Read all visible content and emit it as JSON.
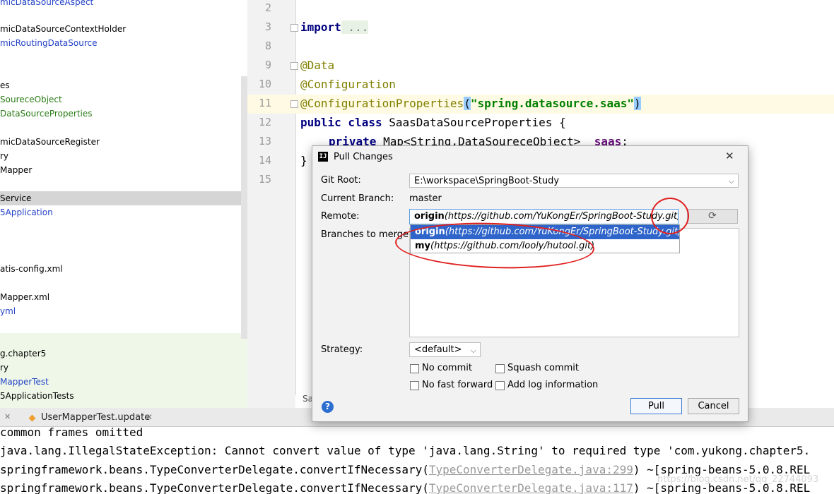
{
  "tree": {
    "items": [
      {
        "text": "micDataSourceAspect",
        "color": "blue"
      },
      {
        "text": "micDataSourceContextHolder",
        "color": "black"
      },
      {
        "text": "micRoutingDataSource",
        "color": "blue"
      },
      {
        "text": "es",
        "color": "black"
      },
      {
        "text": "SoureceObject",
        "color": "green"
      },
      {
        "text": "DataSourceProperties",
        "color": "green"
      },
      {
        "text": "micDataSourceRegister",
        "color": "black"
      },
      {
        "text": "ry",
        "color": "black"
      },
      {
        "text": "Mapper",
        "color": "black"
      },
      {
        "text": "Service",
        "color": "black"
      },
      {
        "text": "5Application",
        "color": "blue"
      },
      {
        "text": "atis-config.xml",
        "color": "black"
      },
      {
        "text": "Mapper.xml",
        "color": "black"
      },
      {
        "text": "yml",
        "color": "blue"
      },
      {
        "text": "g.chapter5",
        "color": "black"
      },
      {
        "text": "ry",
        "color": "black"
      },
      {
        "text": "MapperTest",
        "color": "blue"
      },
      {
        "text": "5ApplicationTests",
        "color": "black"
      }
    ]
  },
  "editor": {
    "line_numbers": [
      "2",
      "3",
      "8",
      "9",
      "10",
      "11",
      "12",
      "13",
      "14",
      "15"
    ],
    "code": {
      "import_kw": "import",
      "import_fold": " ...",
      "ann_data": "@Data",
      "ann_config": "@Configuration",
      "ann_props": "@ConfigurationProperties",
      "props_open": "(",
      "props_str": "\"spring.datasource.saas\"",
      "props_close": ")",
      "class_kw": "public class",
      "class_rest": " SaasDataSourceProperties {",
      "private_kw": "private",
      "field_type": " Map<String,DataSoureceObject>  ",
      "field_name": "saas",
      "field_end": ";",
      "closing": "}"
    },
    "sa_tab": "Sa"
  },
  "bottom_tab": {
    "label": "UserMapperTest.update",
    "close": "✕",
    "left_close": "✕"
  },
  "console": {
    "l1": "common frames omitted",
    "l2": "java.lang.IllegalStateException: Cannot convert value of type 'java.lang.String' to required type 'com.yukong.chapter5.",
    "l3_pre": "springframework.beans.TypeConverterDelegate.convertIfNecessary(",
    "l3_link": "TypeConverterDelegate.java:299",
    "l3_post": ") ~[spring-beans-5.0.8.REL",
    "l4_pre": "springframework.beans.TypeConverterDelegate.convertIfNecessary(",
    "l4_link": "TypeConverterDelegate.java:117",
    "l4_post": ") ~[spring-beans-5.0.8.REL",
    "watermark": "https://blog.csdn.net/qq_22744093"
  },
  "dialog": {
    "title": "Pull Changes",
    "close": "✕",
    "git_root_label": "Git Root:",
    "git_root_value": "E:\\workspace\\SpringBoot-Study",
    "current_branch_label": "Current Branch:",
    "current_branch_value": "master",
    "remote_label": "Remote:",
    "remote_name": "origin",
    "remote_url": "(https://github.com/YuKongEr/SpringBoot-Study.git)",
    "refresh_icon": "⟳",
    "branches_label": "Branches to merge:",
    "dropdown": [
      {
        "name": "origin",
        "url": "(https://github.com/YuKongEr/SpringBoot-Study.git)"
      },
      {
        "name": "my",
        "url": "(https://github.com/looly/hutool.git)"
      }
    ],
    "strategy_label": "Strategy:",
    "strategy_value": "<default>",
    "cb_no_commit": "No commit",
    "cb_squash": "Squash commit",
    "cb_no_ff": "No fast forward",
    "cb_add_log": "Add log information",
    "pull_button": "Pull",
    "cancel_button": "Cancel",
    "help_icon": "?",
    "chevron": "⌵"
  },
  "colors": {
    "annotation_red": "#e02020",
    "selection_blue": "#2f65ca"
  }
}
